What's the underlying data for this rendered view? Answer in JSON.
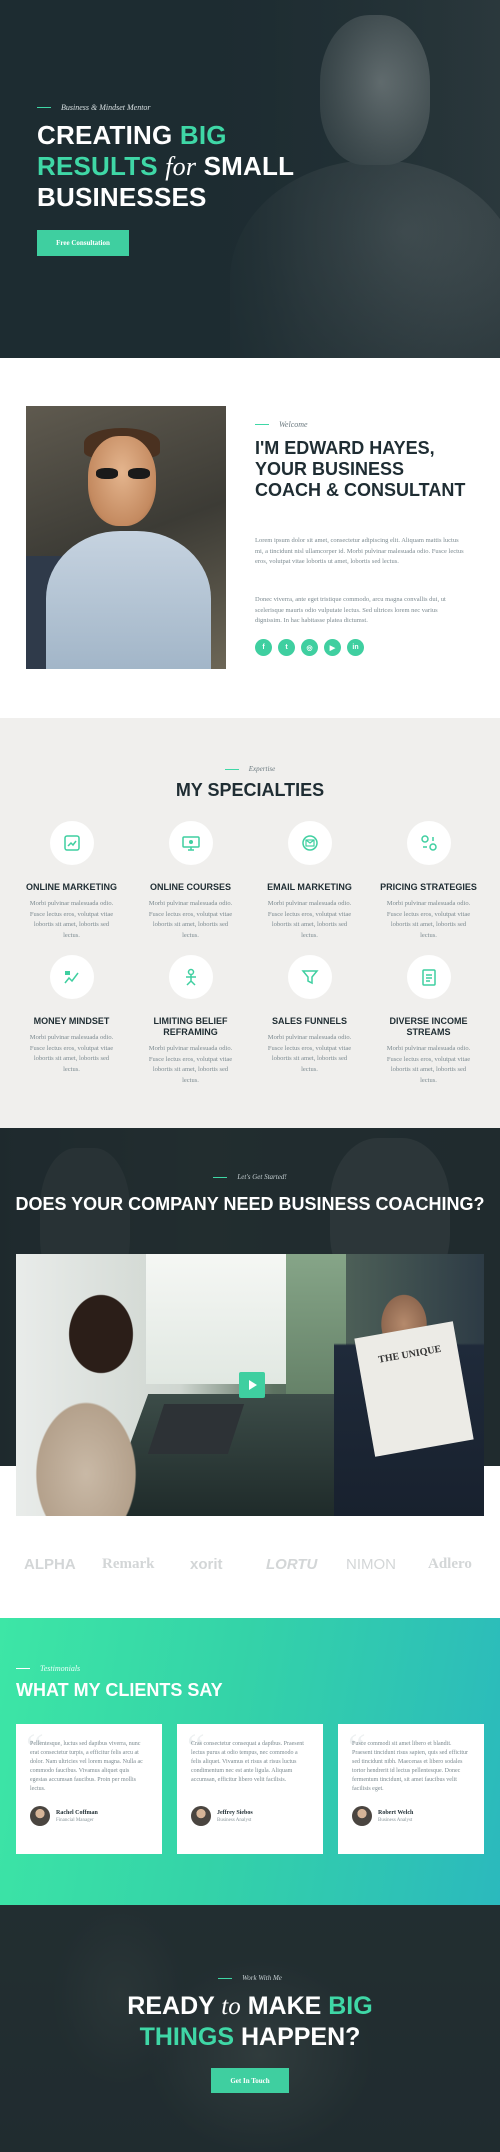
{
  "colors": {
    "accent": "#3fcfa0",
    "dark": "#1f2d33",
    "text_muted": "#7c8a90"
  },
  "hero": {
    "eyebrow": "Business & Mindset Mentor",
    "title_1": "CREATING ",
    "title_big": "BIG",
    "title_results": "RESULTS ",
    "title_for": "for",
    "title_small": " SMALL",
    "title_3": "BUSINESSES",
    "button": "Free Consultation"
  },
  "about": {
    "eyebrow": "Welcome",
    "title": "I'M EDWARD HAYES, YOUR BUSINESS COACH & CONSULTANT",
    "p1": "Lorem ipsum dolor sit amet, consectetur adipiscing elit. Aliquam mattis luctus mi, a tincidunt nisl ullamcorper id. Morbi pulvinar malesuada odio. Fusce lectus eros, volutpat vitae lobortis ut amet, lobortis sed lectus.",
    "p2": "Donec viverra, ante eget tristique commodo, arcu magna convallis dui, ut scelerisque mauris odio vulputate lectus. Sed ultrices lorem nec varius dignissim. In hac habitasse platea dictumst.",
    "socials": [
      {
        "icon": "facebook-icon",
        "glyph": "f"
      },
      {
        "icon": "twitter-icon",
        "glyph": "t"
      },
      {
        "icon": "instagram-icon",
        "glyph": "◎"
      },
      {
        "icon": "youtube-icon",
        "glyph": "▶"
      },
      {
        "icon": "linkedin-icon",
        "glyph": "in"
      }
    ]
  },
  "specialties": {
    "eyebrow": "Expertise",
    "title": "MY SPECIALTIES",
    "items": [
      {
        "title": "ONLINE MARKETING",
        "icon": "marketing-icon",
        "desc": "Morbi pulvinar malesuada odio. Fusce lectus eros, volutpat vitae lobortis sit amet, lobortis sed lectus."
      },
      {
        "title": "ONLINE COURSES",
        "icon": "courses-icon",
        "desc": "Morbi pulvinar malesuada odio. Fusce lectus eros, volutpat vitae lobortis sit amet, lobortis sed lectus."
      },
      {
        "title": "EMAIL MARKETING",
        "icon": "email-icon",
        "desc": "Morbi pulvinar malesuada odio. Fusce lectus eros, volutpat vitae lobortis sit amet, lobortis sed lectus."
      },
      {
        "title": "PRICING STRATEGIES",
        "icon": "pricing-icon",
        "desc": "Morbi pulvinar malesuada odio. Fusce lectus eros, volutpat vitae lobortis sit amet, lobortis sed lectus."
      },
      {
        "title": "MONEY MINDSET",
        "icon": "money-icon",
        "desc": "Morbi pulvinar malesuada odio. Fusce lectus eros, volutpat vitae lobortis sit amet, lobortis sed lectus."
      },
      {
        "title": "LIMITING BELIEF REFRAMING",
        "icon": "belief-icon",
        "desc": "Morbi pulvinar malesuada odio. Fusce lectus eros, volutpat vitae lobortis sit amet, lobortis sed lectus."
      },
      {
        "title": "SALES FUNNELS",
        "icon": "funnel-icon",
        "desc": "Morbi pulvinar malesuada odio. Fusce lectus eros, volutpat vitae lobortis sit amet, lobortis sed lectus."
      },
      {
        "title": "DIVERSE INCOME STREAMS",
        "icon": "income-icon",
        "desc": "Morbi pulvinar malesuada odio. Fusce lectus eros, volutpat vitae lobortis sit amet, lobortis sed lectus."
      }
    ]
  },
  "cta": {
    "eyebrow": "Let's Get Started!",
    "title": "DOES YOUR COMPANY NEED BUSINESS COACHING?",
    "video_paper_text": "THE UNIQUE"
  },
  "logos": [
    "ALPHA",
    "Remark",
    "xorit",
    "LORTU",
    "NIMON",
    "Adlero"
  ],
  "testimonials": {
    "eyebrow": "Testimonials",
    "title": "WHAT MY CLIENTS SAY",
    "items": [
      {
        "text": "Pellentesque, luctus sed dapibus viverra, nunc erat consectetur turpis, a efficitur felis arcu at dolor. Nam ultricies vel lorem magna. Nulla ac commodo faucibus. Vivamus aliquet quis egestas accumsan faucibus. Proin per mollis lectus.",
        "name": "Rachel Coffman",
        "role": "Financial Manager"
      },
      {
        "text": "Cras consectetur consequat a dapibus. Praesent lectus purus at odio tempus, nec commodo a felis aliquet. Vivamus et risus at risus luctus condimentum nec est ante ligula. Aliquam accumsan, efficitur libero velit facilisis.",
        "name": "Jeffrey Siebos",
        "role": "Business Analyst"
      },
      {
        "text": "Fusce commodi sit amet libero et blandit. Praesent tincidunt risus sapien, quis sed efficitur sed tincidunt nibh. Maecenas et libero sodales tortor hendrerit id lectus pellentesque. Donec fermentum tincidunt, sit amet faucibus velit facilisis eget.",
        "name": "Robert Welch",
        "role": "Business Analyst"
      }
    ]
  },
  "final": {
    "eyebrow": "Work With Me",
    "title_ready": "READY ",
    "title_to": "to",
    "title_make": " MAKE ",
    "title_big": "BIG",
    "title_things": "THINGS",
    "title_happen": " HAPPEN?",
    "button": "Get In Touch"
  }
}
